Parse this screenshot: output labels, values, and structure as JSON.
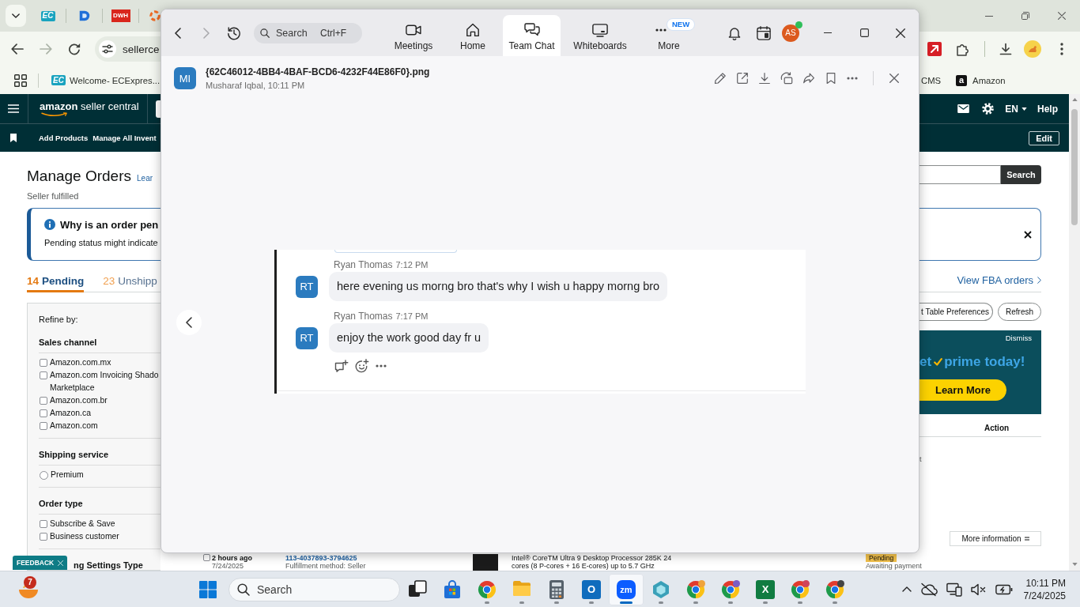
{
  "browser": {
    "tabs": [
      {
        "kind": "ec",
        "text": "EC"
      },
      {
        "kind": "d"
      },
      {
        "kind": "dwh",
        "text": "DWH"
      },
      {
        "kind": "ring"
      }
    ],
    "nav_buttons": [
      {
        "kind": "back",
        "disabled": false
      },
      {
        "kind": "forward",
        "disabled": true
      },
      {
        "kind": "reload",
        "disabled": false
      }
    ],
    "address": {
      "value": "sellerce"
    },
    "bookmarks": [
      {
        "kind": "ec",
        "icon_text": "EC",
        "label": "Welcome- ECExpres..."
      },
      {
        "kind": "plain",
        "label": "CMS"
      },
      {
        "kind": "amazon",
        "icon_text": "a",
        "label": "Amazon"
      }
    ]
  },
  "seller_central": {
    "logo": {
      "brand": "amazon",
      "product": "seller central"
    },
    "language": "EN",
    "help": "Help",
    "nav_items": [
      "Add Products",
      "Manage All Invent"
    ],
    "edit_button": "Edit",
    "title": "Manage Orders",
    "title_link": "Lear",
    "subtitle": "Seller fulfilled",
    "search_button": "Search",
    "alert": {
      "title": "Why is an order pen",
      "text": "Pending status might indicate"
    },
    "tabs": [
      {
        "count": "14",
        "label": "Pending",
        "selected": true
      },
      {
        "count": "23",
        "label": "Unshipp",
        "selected": false
      }
    ],
    "fba_link": "View FBA orders",
    "filters": {
      "title": "Refine by:",
      "groups": [
        {
          "title": "Sales channel",
          "options": [
            {
              "kind": "checkbox",
              "label": "Amazon.com.mx",
              "checked": false
            },
            {
              "kind": "checkbox",
              "label": "Amazon.com Invoicing Shado Marketplace",
              "checked": false
            },
            {
              "kind": "checkbox",
              "label": "Amazon.com.br",
              "checked": false
            },
            {
              "kind": "checkbox",
              "label": "Amazon.ca",
              "checked": false
            },
            {
              "kind": "checkbox",
              "label": "Amazon.com",
              "checked": false
            }
          ]
        },
        {
          "title": "Shipping service",
          "options": [
            {
              "kind": "radio",
              "label": "Premium",
              "checked": false
            }
          ]
        },
        {
          "title": "Order type",
          "options": [
            {
              "kind": "checkbox",
              "label": "Subscribe & Save",
              "checked": false
            },
            {
              "kind": "checkbox",
              "label": "Business customer",
              "checked": false
            }
          ]
        },
        {
          "title": "ng Settings Type"
        }
      ]
    },
    "feedback": "FEEDBACK",
    "table_buttons": [
      "t Table Preferences",
      "Refresh"
    ],
    "prime_banner": {
      "dismiss": "Dismiss",
      "headline_start": "et",
      "headline_brand": "prime",
      "headline_end": "today!",
      "cta": "Learn More"
    },
    "table": {
      "columns": [
        "Action"
      ],
      "column_fragment": "t",
      "rows": [
        {
          "checked": false,
          "age": "2 hours ago",
          "date": "7/24/2025",
          "order_id": "113-4037893-3794625",
          "fulfillment": "Fulfillment method: Seller",
          "product": [
            "Intel® CoreTM Ultra 9 Desktop Processor 285K 24",
            "cores (8 P-cores + 16 E-cores) up to 5.7 GHz"
          ],
          "status": "Pending",
          "status_note": "Awaiting payment"
        }
      ]
    },
    "more_information": "More information"
  },
  "zoom": {
    "nav_buttons": [
      {
        "kind": "back",
        "disabled": false
      },
      {
        "kind": "forward",
        "disabled": true
      },
      {
        "kind": "history",
        "disabled": false
      }
    ],
    "search": {
      "placeholder": "Search",
      "shortcut": "Ctrl+F"
    },
    "tabs": [
      {
        "kind": "meetings",
        "label": "Meetings",
        "selected": false
      },
      {
        "kind": "home",
        "label": "Home",
        "selected": false
      },
      {
        "kind": "chat",
        "label": "Team Chat",
        "selected": true
      },
      {
        "kind": "whiteboards",
        "label": "Whiteboards",
        "selected": false
      },
      {
        "kind": "more",
        "label": "More",
        "selected": false,
        "badge": "NEW"
      }
    ],
    "profile": {
      "initials": "AS",
      "online": true
    },
    "file": {
      "initials": "MI",
      "name": "{62C46012-4BB4-4BAF-BCD6-4232F44E86F0}.png",
      "sender": "Musharaf Iqbal, 10:11 PM"
    },
    "image": {
      "messages": [
        {
          "initials": "RT",
          "author": "Ryan Thomas",
          "time": "7:12 PM",
          "text": "here evening us morng bro that's why I wish u happy morng bro"
        },
        {
          "initials": "RT",
          "author": "Ryan Thomas",
          "time": "7:17 PM",
          "text": "enjoy the work good day fr u"
        }
      ]
    }
  },
  "taskbar": {
    "widget_badge": "7",
    "search": {
      "placeholder": "Search"
    },
    "apps": [
      {
        "kind": "task-view",
        "running": false,
        "selected": false
      },
      {
        "kind": "store",
        "running": false,
        "selected": false
      },
      {
        "kind": "chrome",
        "running": true,
        "selected": false
      },
      {
        "kind": "files",
        "running": true,
        "selected": false
      },
      {
        "kind": "calculator",
        "running": true,
        "selected": false
      },
      {
        "kind": "outlook",
        "glyph": "O",
        "running": true,
        "selected": false
      },
      {
        "kind": "zoom",
        "glyph": "zm",
        "running": true,
        "selected": true
      },
      {
        "kind": "gem",
        "running": true,
        "selected": false
      },
      {
        "kind": "chrome-profile",
        "color": "#f0a33a",
        "running": true,
        "selected": false
      },
      {
        "kind": "chrome-profile",
        "color": "#7b5cc4",
        "running": true,
        "selected": false
      },
      {
        "kind": "excel",
        "glyph": "X",
        "running": true,
        "selected": false
      },
      {
        "kind": "chrome-profile",
        "color": "#d0445a",
        "running": true,
        "selected": false
      },
      {
        "kind": "chrome-profile",
        "color": "#444444",
        "running": true,
        "selected": false
      }
    ],
    "clock": {
      "time": "10:11 PM",
      "date": "7/24/2025"
    }
  }
}
